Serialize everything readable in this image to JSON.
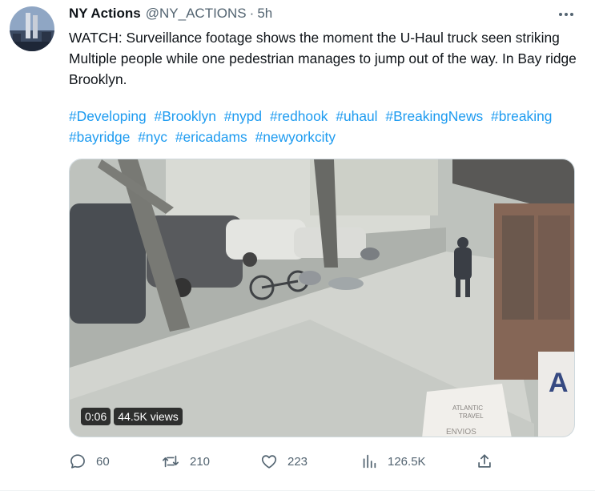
{
  "tweet": {
    "author_name": "NY Actions",
    "handle": "@NY_ACTIONS",
    "separator": "·",
    "time": "5h",
    "text": "WATCH: Surveillance footage shows the moment the U-Haul truck seen striking Multiple people while one pedestrian manages to jump out of the way. In Bay ridge Brooklyn.",
    "hashtags": [
      "#Developing",
      "#Brooklyn",
      "#nypd",
      "#redhook",
      "#uhaul",
      "#BreakingNews",
      "#breaking",
      "#bayridge",
      "#nyc",
      "#ericadams",
      "#newyorkcity"
    ]
  },
  "video": {
    "duration": "0:06",
    "views": "44.5K views",
    "sign_text_1": "ATLANTIC",
    "sign_text_2": "TRAVEL",
    "sign_text_3": "ENVIOS"
  },
  "actions": {
    "replies": "60",
    "retweets": "210",
    "likes": "223",
    "views": "126.5K"
  },
  "icons": {
    "more": "more-dots-icon",
    "reply": "reply-icon",
    "retweet": "retweet-icon",
    "like": "heart-icon",
    "views": "bar-chart-icon",
    "share": "share-icon"
  },
  "colors": {
    "link": "#1d9bf0",
    "secondary_text": "#536471",
    "primary_text": "#0f1419"
  }
}
